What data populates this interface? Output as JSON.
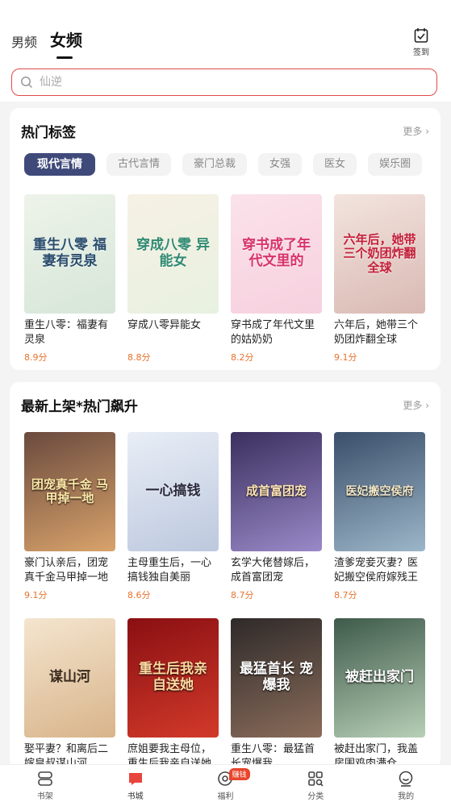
{
  "header": {
    "tabs": [
      {
        "label": "男频",
        "active": false
      },
      {
        "label": "女频",
        "active": true
      }
    ],
    "signin_label": "签到"
  },
  "search": {
    "placeholder": "仙逆"
  },
  "section_hot_tags": {
    "title": "热门标签",
    "more": "更多 ›",
    "chips": [
      "现代言情",
      "古代言情",
      "豪门总裁",
      "女强",
      "医女",
      "娱乐圈"
    ],
    "active_chip": "现代言情",
    "books": [
      {
        "title": "重生八零：福妻有灵泉",
        "score": "8.9分",
        "cover_text": "重生八零 福妻有灵泉"
      },
      {
        "title": "穿成八零异能女",
        "score": "8.8分",
        "cover_text": "穿成八零 异能女"
      },
      {
        "title": "穿书成了年代文里的姑奶奶",
        "score": "8.2分",
        "cover_text": "穿书成了年代文里的"
      },
      {
        "title": "六年后，她带三个奶团炸翻全球",
        "score": "9.1分",
        "cover_text": "六年后，她带三个奶团炸翻全球"
      }
    ]
  },
  "section_new": {
    "title": "最新上架*热门飙升",
    "more": "更多 ›",
    "books_row1": [
      {
        "title": "豪门认亲后，团宠真千金马甲掉一地",
        "score": "9.1分",
        "cover_text": "团宠真千金 马甲掉一地"
      },
      {
        "title": "主母重生后，一心搞钱独自美丽",
        "score": "8.6分",
        "cover_text": "一心搞钱"
      },
      {
        "title": "玄学大佬替嫁后，成首富团宠",
        "score": "8.7分",
        "cover_text": "成首富团宠"
      },
      {
        "title": "渣爹宠妾灭妻？医妃搬空侯府嫁残王",
        "score": "8.7分",
        "cover_text": "医妃搬空侯府"
      }
    ],
    "books_row2": [
      {
        "title": "娶平妻？和离后二嫁皇叔谋山河",
        "score": "",
        "cover_text": "谋山河"
      },
      {
        "title": "庶姐要我主母位，重生后我亲自送她",
        "score": "",
        "cover_text": "重生后我亲自送她"
      },
      {
        "title": "重生八零：最猛首长宠爆我",
        "score": "",
        "cover_text": "最猛首长 宠爆我"
      },
      {
        "title": "被赶出家门，我盖房围鸡肉满仓",
        "score": "",
        "cover_text": "被赶出家门"
      }
    ]
  },
  "bottom_nav": [
    {
      "label": "书架",
      "icon": "bookshelf-icon",
      "active": false
    },
    {
      "label": "书城",
      "icon": "bookstore-icon",
      "active": true
    },
    {
      "label": "福利",
      "icon": "welfare-icon",
      "active": false,
      "badge": "赚钱"
    },
    {
      "label": "分类",
      "icon": "category-icon",
      "active": false
    },
    {
      "label": "我的",
      "icon": "profile-icon",
      "active": false
    }
  ],
  "colors": {
    "accent_red": "#e04a4a",
    "chip_active": "#3f4a7a",
    "score_orange": "#e8722c"
  }
}
